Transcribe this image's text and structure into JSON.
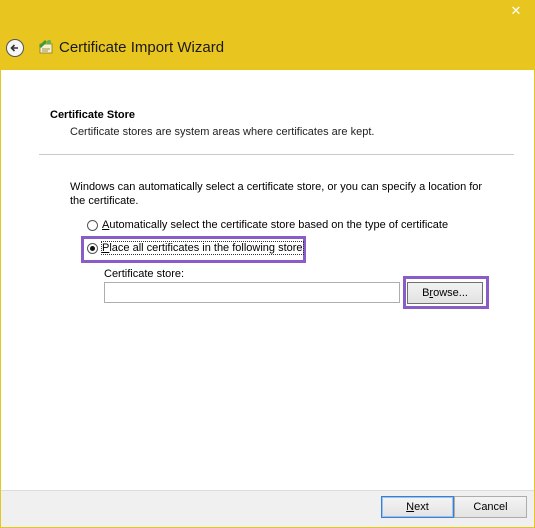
{
  "window": {
    "title": "Certificate Import Wizard",
    "accent": "#e9c51f",
    "close_glyph": "✕"
  },
  "header": {
    "section_title": "Certificate Store",
    "section_desc": "Certificate stores are system areas where certificates are kept."
  },
  "body": {
    "intro": "Windows can automatically select a certificate store, or you can specify a location for the certificate.",
    "option_auto": {
      "mnemonic": "A",
      "rest": "utomatically select the certificate store based on the type of certificate",
      "selected": false
    },
    "option_manual": {
      "mnemonic": "P",
      "rest": "lace all certificates in the following store",
      "selected": true
    },
    "store_label": "Certificate store:",
    "store_value": "",
    "browse": {
      "mnemonic": "r",
      "before": "B",
      "after": "owse..."
    }
  },
  "footer": {
    "next": {
      "mnemonic": "N",
      "rest": "ext"
    },
    "cancel": "Cancel"
  },
  "highlight_color": "#8a5cc7"
}
